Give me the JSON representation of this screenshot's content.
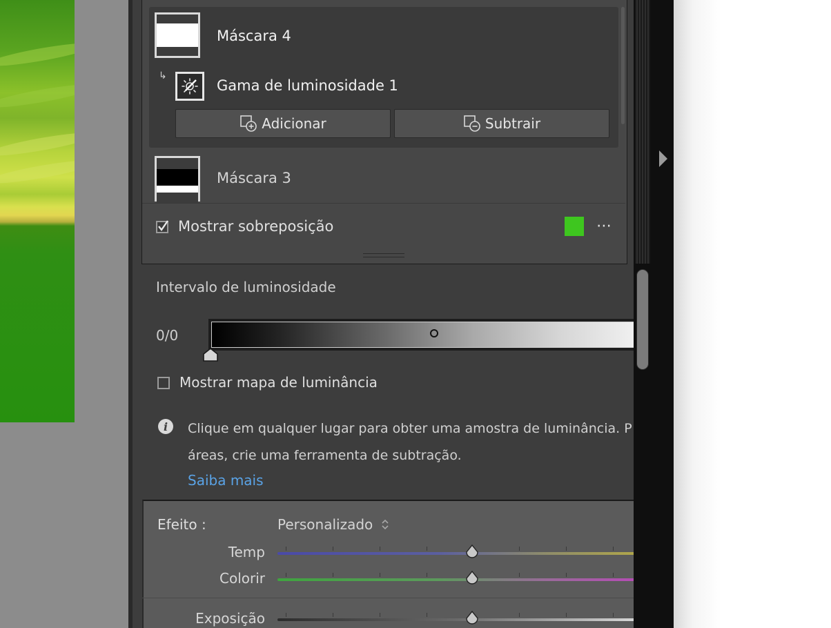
{
  "masks": {
    "mask4": {
      "name": "Máscara 4"
    },
    "sub_component": {
      "name": "Gama de luminosidade 1"
    },
    "add_button": "Adicionar",
    "subtract_button": "Subtrair",
    "mask3": {
      "name": "Máscara 3"
    }
  },
  "overlay": {
    "label": "Mostrar sobreposição",
    "checked": true,
    "color": "#3ec61f",
    "more_icon": "⋯"
  },
  "luminance_range": {
    "title": "Intervalo de luminosidade",
    "value_label": "0/0",
    "show_map_label": "Mostrar mapa de luminância",
    "show_map_checked": false,
    "info_line1": "Clique em qualquer lugar para obter uma amostra de luminância. P",
    "info_line2": "áreas, crie uma ferramenta de subtração.",
    "learn_more": "Saiba mais"
  },
  "effect": {
    "label": "Efeito :",
    "preset": "Personalizado",
    "sliders": [
      {
        "name": "Temp",
        "value": 0
      },
      {
        "name": "Colorir",
        "value": 0
      },
      {
        "name": "Exposição",
        "value": 0
      }
    ]
  }
}
